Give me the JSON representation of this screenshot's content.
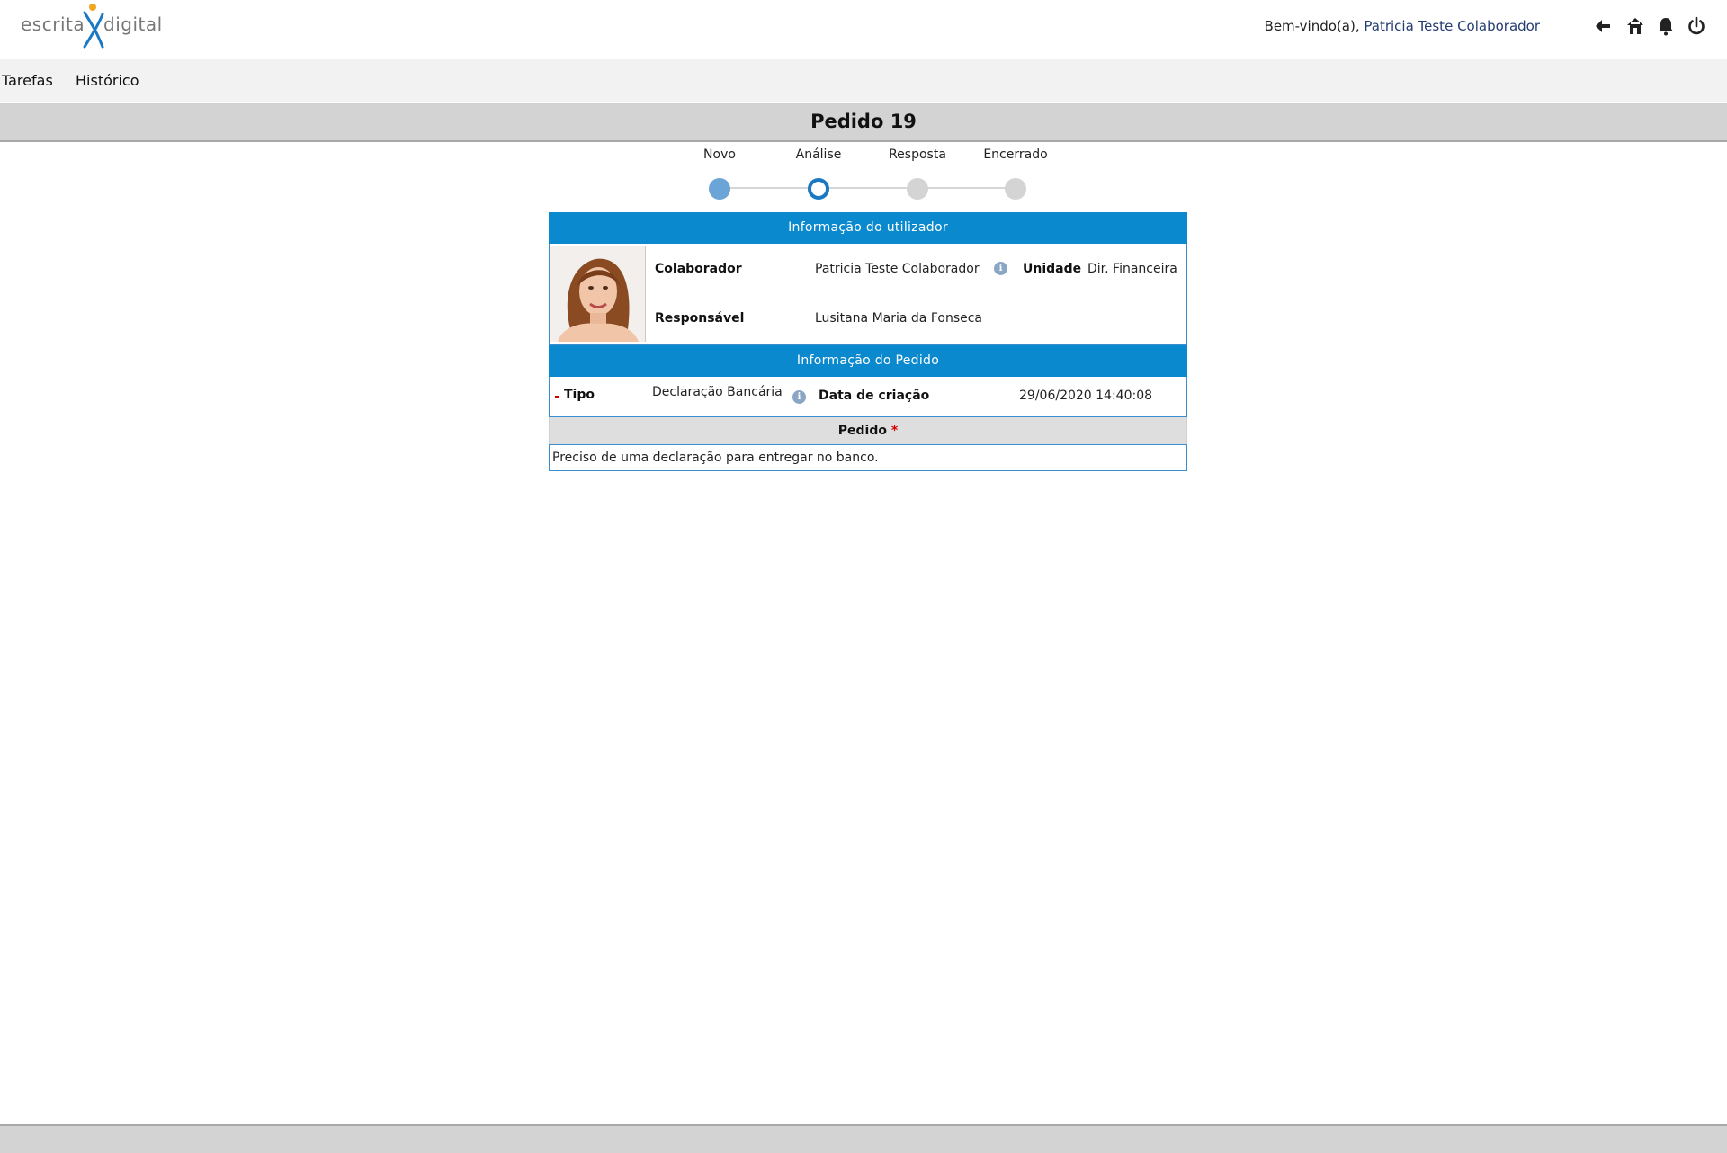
{
  "header": {
    "logo_left": "escrita",
    "logo_right": "digital",
    "welcome_prefix": "Bem-vindo(a),",
    "user_name": "Patricia Teste Colaborador",
    "icons": [
      "back-arrow-icon",
      "home-icon",
      "bell-icon",
      "power-icon"
    ]
  },
  "menu": {
    "items": [
      {
        "label": "Tarefas"
      },
      {
        "label": "Histórico"
      }
    ]
  },
  "page": {
    "title": "Pedido 19"
  },
  "steps": {
    "items": [
      {
        "label": "Novo",
        "state": "done"
      },
      {
        "label": "Análise",
        "state": "current"
      },
      {
        "label": "Resposta",
        "state": "future"
      },
      {
        "label": "Encerrado",
        "state": "future"
      }
    ]
  },
  "user_info": {
    "heading": "Informação do utilizador",
    "colaborador_label": "Colaborador",
    "colaborador_value": "Patricia Teste Colaborador",
    "unidade_label": "Unidade",
    "unidade_value": "Dir. Financeira",
    "responsavel_label": "Responsável",
    "responsavel_value": "Lusitana Maria da Fonseca"
  },
  "request_info": {
    "heading": "Informação do Pedido",
    "tipo_label": "Tipo",
    "tipo_value": "Declaração Bancária",
    "data_label": "Data de criação",
    "data_value": "29/06/2020 14:40:08"
  },
  "pedido": {
    "label": "Pedido",
    "required_mark": "*",
    "text": "Preciso de uma declaração para entregar no banco."
  },
  "colors": {
    "accent": "#0a89ce",
    "step_done": "#6ba4d6",
    "step_current": "#1979c4",
    "required": "#d40000"
  }
}
